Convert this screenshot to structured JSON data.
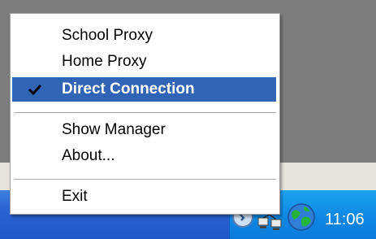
{
  "menu": {
    "items": [
      {
        "label": "School Proxy",
        "checked": false,
        "highlighted": false
      },
      {
        "label": "Home Proxy",
        "checked": false,
        "highlighted": false
      },
      {
        "label": "Direct Connection",
        "checked": true,
        "highlighted": true
      },
      {
        "label": "Show Manager",
        "checked": false,
        "highlighted": false
      },
      {
        "label": "About...",
        "checked": false,
        "highlighted": false
      },
      {
        "label": "Exit",
        "checked": false,
        "highlighted": false
      }
    ]
  },
  "tray": {
    "clock": "11:06",
    "icons": [
      "round-tray-icon",
      "network-connections-icon",
      "globe-icon"
    ]
  },
  "colors": {
    "highlight": "#3164b4",
    "taskbar": "#2a63d2",
    "tray": "#0f8ae4",
    "desktop": "#7d7d7d"
  }
}
